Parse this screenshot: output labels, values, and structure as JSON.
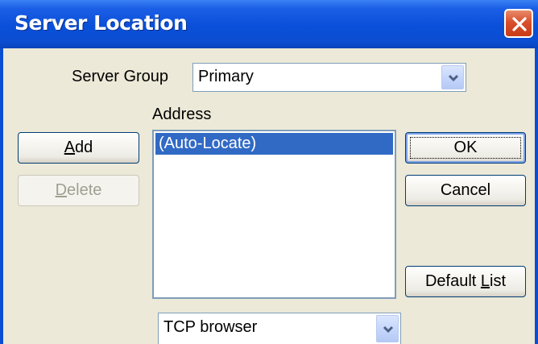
{
  "window": {
    "title": "Server Location",
    "close_icon": "close-icon"
  },
  "server_group": {
    "label": "Server Group",
    "value": "Primary"
  },
  "address": {
    "label": "Address",
    "items": [
      "(Auto-Locate)"
    ],
    "selected_index": 0
  },
  "buttons": {
    "add": {
      "pre": "",
      "accel": "A",
      "post": "dd"
    },
    "delete": {
      "pre": "",
      "accel": "D",
      "post": "elete"
    },
    "ok": "OK",
    "cancel": "Cancel",
    "default_list": {
      "pre": "Default ",
      "accel": "L",
      "post": "ist"
    }
  },
  "protocol": {
    "value": "TCP browser"
  },
  "colors": {
    "titlebar": "#0a4fd8",
    "selection": "#316ac5",
    "dialog_bg": "#ece9d8"
  }
}
